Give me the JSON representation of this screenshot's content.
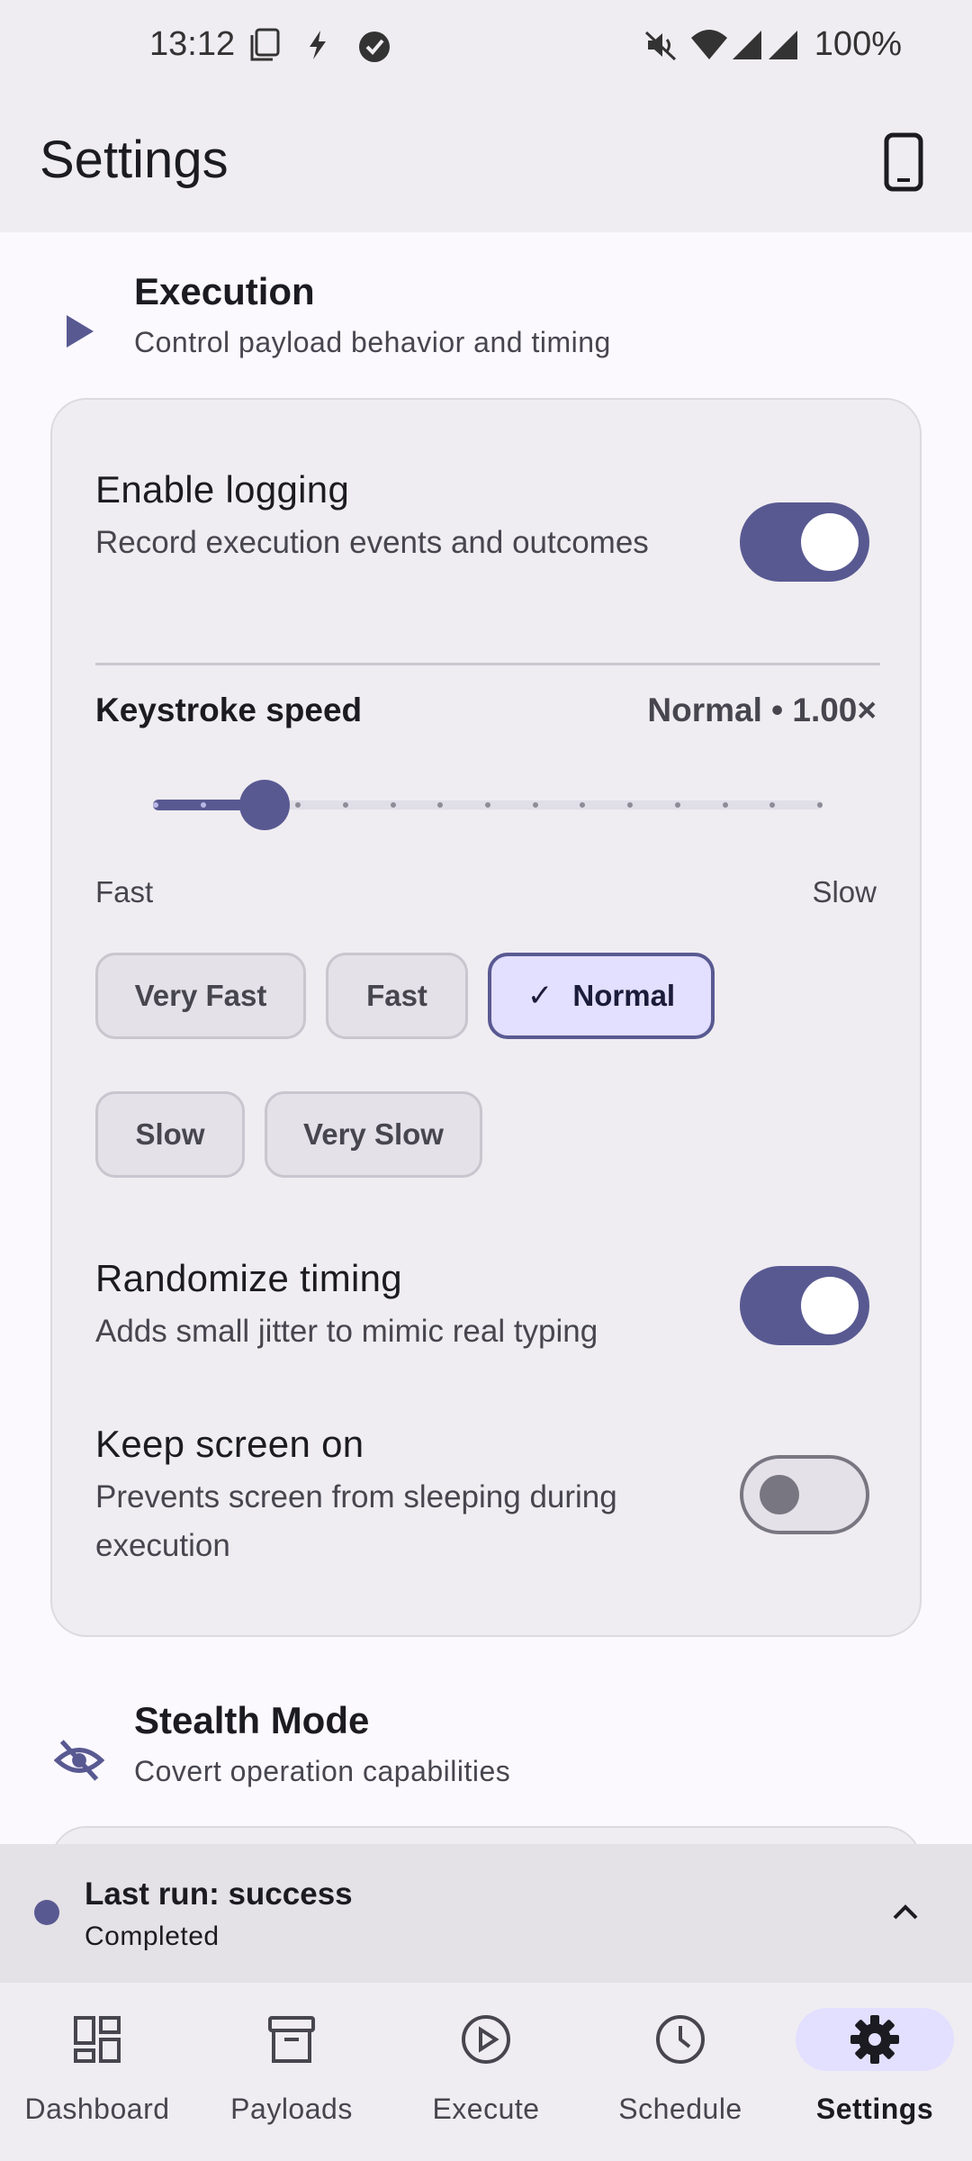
{
  "status_bar": {
    "time": "13:12",
    "battery": "100%"
  },
  "app_bar": {
    "title": "Settings"
  },
  "execution": {
    "title": "Execution",
    "subtitle": "Control payload behavior and timing",
    "logging": {
      "title": "Enable logging",
      "subtitle": "Record execution events and outcomes",
      "enabled": true
    },
    "keystroke": {
      "label": "Keystroke speed",
      "value": "Normal • 1.00×",
      "range_left": "Fast",
      "range_right": "Slow",
      "slider_fraction": 0.167,
      "presets": [
        "Very Fast",
        "Fast",
        "Normal",
        "Slow",
        "Very Slow"
      ],
      "selected": "Normal"
    },
    "randomize": {
      "title": "Randomize timing",
      "subtitle": "Adds small jitter to mimic real typing",
      "enabled": true
    },
    "keep_screen": {
      "title": "Keep screen on",
      "subtitle": "Prevents screen from sleeping during execution",
      "enabled": false
    }
  },
  "stealth": {
    "title": "Stealth Mode",
    "subtitle": "Covert operation capabilities"
  },
  "last_run": {
    "title": "Last run: success",
    "subtitle": "Completed"
  },
  "nav": {
    "items": [
      {
        "label": "Dashboard",
        "icon": "dashboard-icon"
      },
      {
        "label": "Payloads",
        "icon": "archive-icon"
      },
      {
        "label": "Execute",
        "icon": "play-circle-icon"
      },
      {
        "label": "Schedule",
        "icon": "clock-icon"
      },
      {
        "label": "Settings",
        "icon": "gear-icon"
      }
    ],
    "active": "Settings"
  },
  "colors": {
    "accent": "#595992",
    "surface": "#efedf1",
    "background": "#fbf8fe"
  }
}
